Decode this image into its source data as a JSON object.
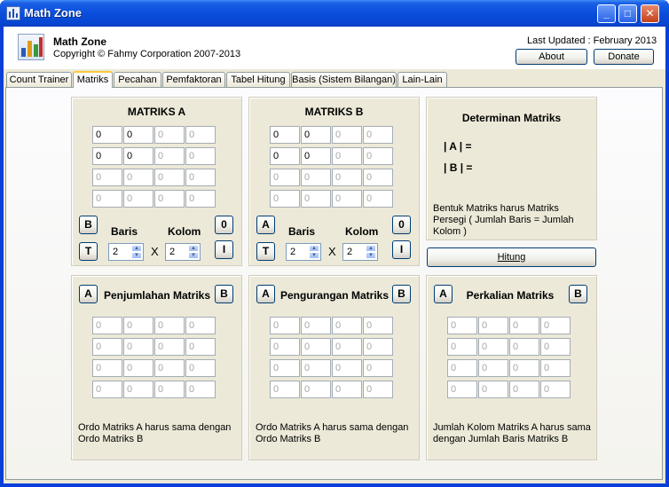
{
  "window": {
    "title": "Math Zone",
    "min": "_",
    "max": "□",
    "close": "✕"
  },
  "header": {
    "app_name": "Math Zone",
    "copyright": "Copyright © Fahmy Corporation 2007-2013",
    "last_updated": "Last Updated : February 2013",
    "about_label": "About",
    "donate_label": "Donate"
  },
  "tabs": [
    "Count Trainer",
    "Matriks",
    "Pecahan",
    "Pemfaktoran",
    "Tabel Hitung",
    "Basis (Sistem Bilangan)",
    "Lain-Lain"
  ],
  "matriks_a": {
    "title": "MATRIKS A",
    "cells": [
      [
        "0",
        "0",
        "0",
        "0"
      ],
      [
        "0",
        "0",
        "0",
        "0"
      ],
      [
        "0",
        "0",
        "0",
        "0"
      ],
      [
        "0",
        "0",
        "0",
        "0"
      ]
    ],
    "btn_b": "B",
    "btn_t": "T",
    "btn_0": "0",
    "btn_i": "I",
    "baris_label": "Baris",
    "kolom_label": "Kolom",
    "baris_value": "2",
    "kolom_value": "2",
    "times": "X"
  },
  "matriks_b": {
    "title": "MATRIKS B",
    "cells": [
      [
        "0",
        "0",
        "0",
        "0"
      ],
      [
        "0",
        "0",
        "0",
        "0"
      ],
      [
        "0",
        "0",
        "0",
        "0"
      ],
      [
        "0",
        "0",
        "0",
        "0"
      ]
    ],
    "btn_a": "A",
    "btn_t": "T",
    "btn_0": "0",
    "btn_i": "I",
    "baris_label": "Baris",
    "kolom_label": "Kolom",
    "baris_value": "2",
    "kolom_value": "2",
    "times": "X"
  },
  "determinan": {
    "title": "Determinan Matriks",
    "det_a": "| A | =",
    "det_b": "| B | =",
    "note": "Bentuk Matriks harus Matriks Persegi ( Jumlah Baris = Jumlah Kolom )",
    "hitung_label": "Hitung"
  },
  "penjumlahan": {
    "title": "Penjumlahan Matriks",
    "btn_a": "A",
    "btn_b": "B",
    "cells": [
      [
        "0",
        "0",
        "0",
        "0"
      ],
      [
        "0",
        "0",
        "0",
        "0"
      ],
      [
        "0",
        "0",
        "0",
        "0"
      ],
      [
        "0",
        "0",
        "0",
        "0"
      ]
    ],
    "note": "Ordo Matriks A harus sama dengan Ordo Matriks B"
  },
  "pengurangan": {
    "title": "Pengurangan Matriks",
    "btn_a": "A",
    "btn_b": "B",
    "cells": [
      [
        "0",
        "0",
        "0",
        "0"
      ],
      [
        "0",
        "0",
        "0",
        "0"
      ],
      [
        "0",
        "0",
        "0",
        "0"
      ],
      [
        "0",
        "0",
        "0",
        "0"
      ]
    ],
    "note": "Ordo Matriks A harus sama dengan Ordo Matriks B"
  },
  "perkalian": {
    "title": "Perkalian Matriks",
    "btn_a": "A",
    "btn_b": "B",
    "cells": [
      [
        "0",
        "0",
        "0",
        "0"
      ],
      [
        "0",
        "0",
        "0",
        "0"
      ],
      [
        "0",
        "0",
        "0",
        "0"
      ],
      [
        "0",
        "0",
        "0",
        "0"
      ]
    ],
    "note": "Jumlah Kolom Matriks A harus sama dengan Jumlah Baris Matriks B"
  },
  "colors": {
    "titlebar": "#0a4edc",
    "panel": "#ece9d8",
    "active_tab_accent": "#ffc83c"
  }
}
